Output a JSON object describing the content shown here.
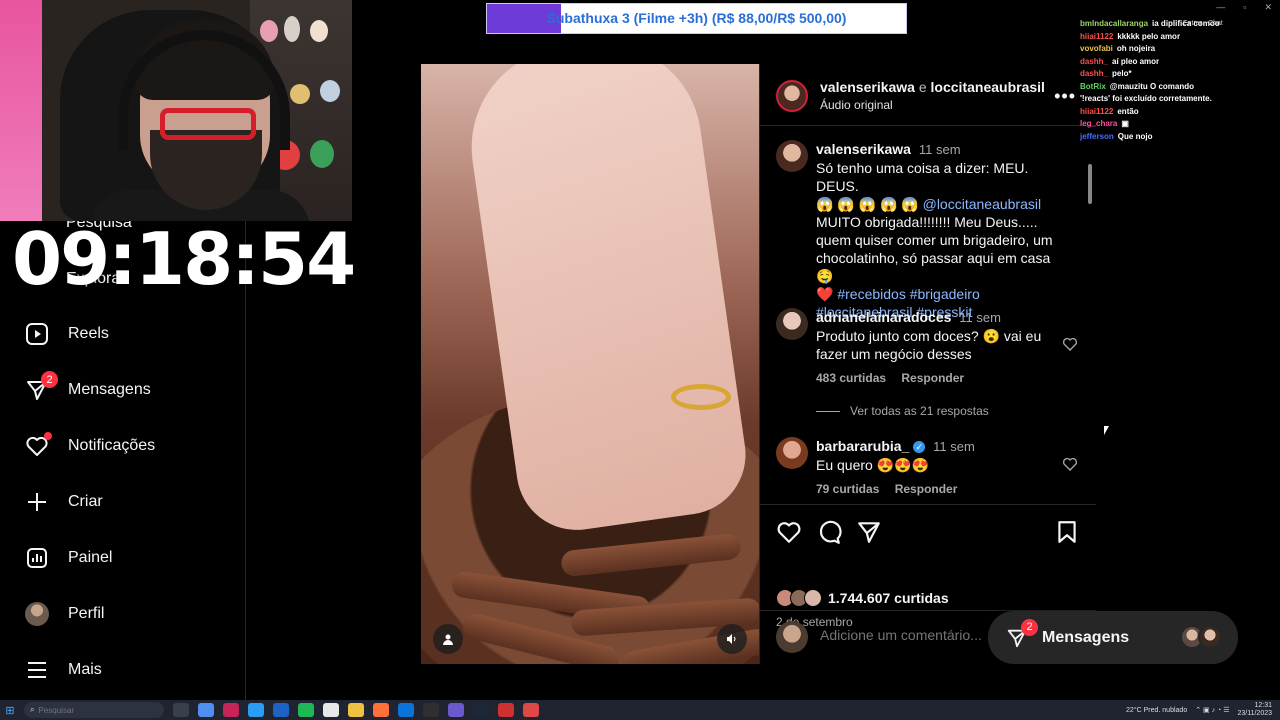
{
  "sub_alert": {
    "text": "Subathuxa 3 (Filme +3h) (R$ 88,00/R$ 500,00)",
    "progress_fraction": 0.176,
    "fill_color": "#6f3bd8"
  },
  "clock": "09:18:54",
  "nav": {
    "ghost_items": [
      "Pesquisa",
      "Explorar"
    ],
    "items": [
      {
        "label": "Reels",
        "icon": "reels-icon"
      },
      {
        "label": "Mensagens",
        "icon": "messages-icon",
        "badge": "2"
      },
      {
        "label": "Notificações",
        "icon": "heart-icon"
      },
      {
        "label": "Criar",
        "icon": "plus-icon"
      },
      {
        "label": "Painel",
        "icon": "dashboard-icon"
      },
      {
        "label": "Perfil",
        "icon": "profile-avatar"
      },
      {
        "label": "Mais",
        "icon": "menu-icon"
      }
    ]
  },
  "post": {
    "author": "valenserikawa",
    "conj": "e",
    "coauthor": "loccitaneaubrasil",
    "audio": "Áudio original",
    "caption": {
      "user": "valenserikawa",
      "time": "11 sem",
      "text1": "Só tenho uma coisa a dizer: MEU. DEUS.",
      "emojis": "😱 😱 😱 😱 😱",
      "mention": "@loccitaneaubrasil",
      "text2": "MUITO obrigada!!!!!!!! Meu Deus..... quem quiser comer um brigadeiro, um chocolatinho, só passar aqui em casa 🤤",
      "heart": "❤️",
      "hashtags1": "#recebidos #brigadeiro",
      "hashtags2": "#loccitanebrasil #presskit"
    },
    "comments": [
      {
        "user": "adrianelainaradoces",
        "time": "11 sem",
        "text": "Produto junto com doces? 😮 vai eu fazer um negócio desses",
        "likes": "483 curtidas",
        "reply": "Responder"
      },
      {
        "user": "barbararubia_",
        "time": "11 sem",
        "text": "Eu quero 😍😍😍",
        "likes": "79 curtidas",
        "reply": "Responder"
      }
    ],
    "view_replies": "Ver todas as 21 respostas",
    "likes": "1.744.607 curtidas",
    "date": "2 de setembro",
    "comment_placeholder": "Adicione um comentário..."
  },
  "messages_bubble": {
    "label": "Mensagens",
    "badge": "2"
  },
  "chat": {
    "header": "Entrar",
    "header2": "Chat",
    "lines": [
      {
        "user": "bmlndacallaranga",
        "msg": "ia diplifica comoo",
        "color": "#9fd36a"
      },
      {
        "user": "hiiai1122",
        "msg": "kkkkk pelo amor",
        "color": "#ff4d4d"
      },
      {
        "user": "vovofabi",
        "msg": "oh nojeira",
        "color": "#e8c34a"
      },
      {
        "user": "dashh_",
        "msg": "aí pleo amor",
        "color": "#ff4d4d"
      },
      {
        "user": "dashh_",
        "msg": "pelo*",
        "color": "#ff4d4d"
      },
      {
        "user": "BotRix",
        "msg": "@mauzitu O comando '!reacts' foi excluído corretamente.",
        "color": "#5fd35f"
      },
      {
        "user": "hiiai1122",
        "msg": "então",
        "color": "#ff4d4d"
      },
      {
        "user": "leg_chara",
        "msg": "▣",
        "color": "#ff4fa0"
      },
      {
        "user": "jefferson",
        "msg": "Que nojo",
        "color": "#4a6cff"
      }
    ]
  },
  "taskbar": {
    "search_placeholder": "Pesquisar",
    "weather": "22°C  Pred. nublado",
    "time": "12:31",
    "date": "23/11/2023"
  }
}
